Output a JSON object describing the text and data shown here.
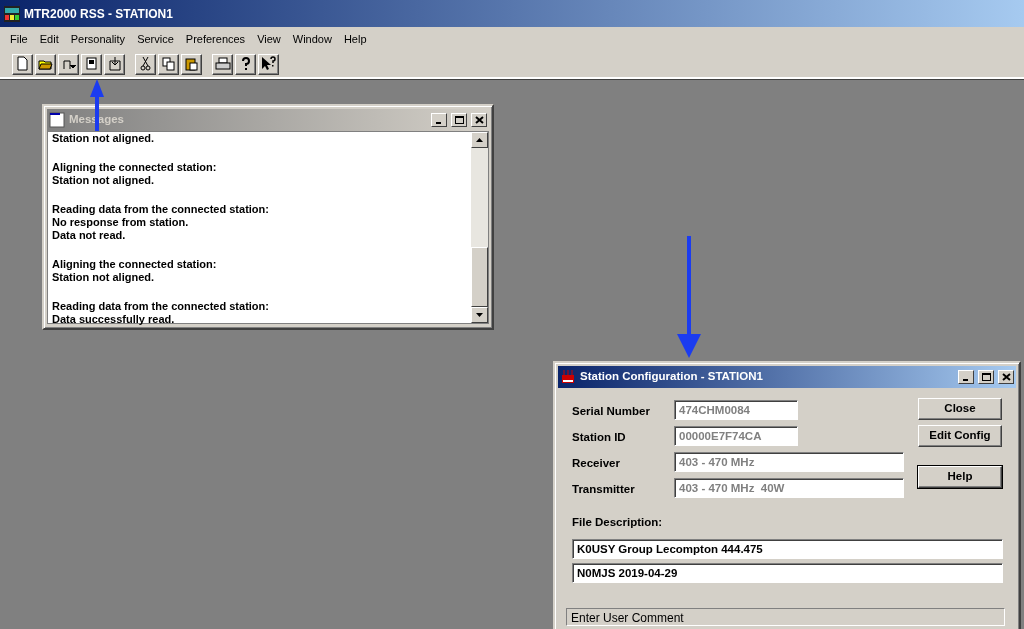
{
  "app": {
    "title": "MTR2000 RSS - STATION1"
  },
  "menu": [
    "File",
    "Edit",
    "Personality",
    "Service",
    "Preferences",
    "View",
    "Window",
    "Help"
  ],
  "messages": {
    "title": "Messages",
    "active": false,
    "entries": [
      [
        "Station not aligned."
      ],
      [
        "Aligning the connected station:",
        "Station not aligned."
      ],
      [
        "Reading data from the connected station:",
        "No response from station.",
        "Data not read."
      ],
      [
        "Aligning the connected station:",
        "Station not aligned."
      ],
      [
        "Reading data from the connected station:",
        "Data successfully read."
      ]
    ]
  },
  "config": {
    "title": "Station Configuration - STATION1",
    "active": true,
    "fields": [
      {
        "label": "Serial Number",
        "value": "474CHM0084",
        "disabled": true
      },
      {
        "label": "Station ID",
        "value": "00000E7F74CA",
        "disabled": true
      },
      {
        "label": "Receiver",
        "value": "403 - 470 MHz",
        "disabled": true
      },
      {
        "label": "Transmitter",
        "value": "403 - 470 MHz  40W",
        "disabled": true
      }
    ],
    "buttons": [
      {
        "label": "Close",
        "default": false
      },
      {
        "label": "Edit Config",
        "default": false
      },
      {
        "label": "Help",
        "default": true
      }
    ],
    "description_label": "File Description:",
    "description_lines": [
      "K0USY Group Lecompton 444.475",
      "N0MJS 2019-04-29"
    ],
    "status_bar": "Enter User Comment"
  }
}
